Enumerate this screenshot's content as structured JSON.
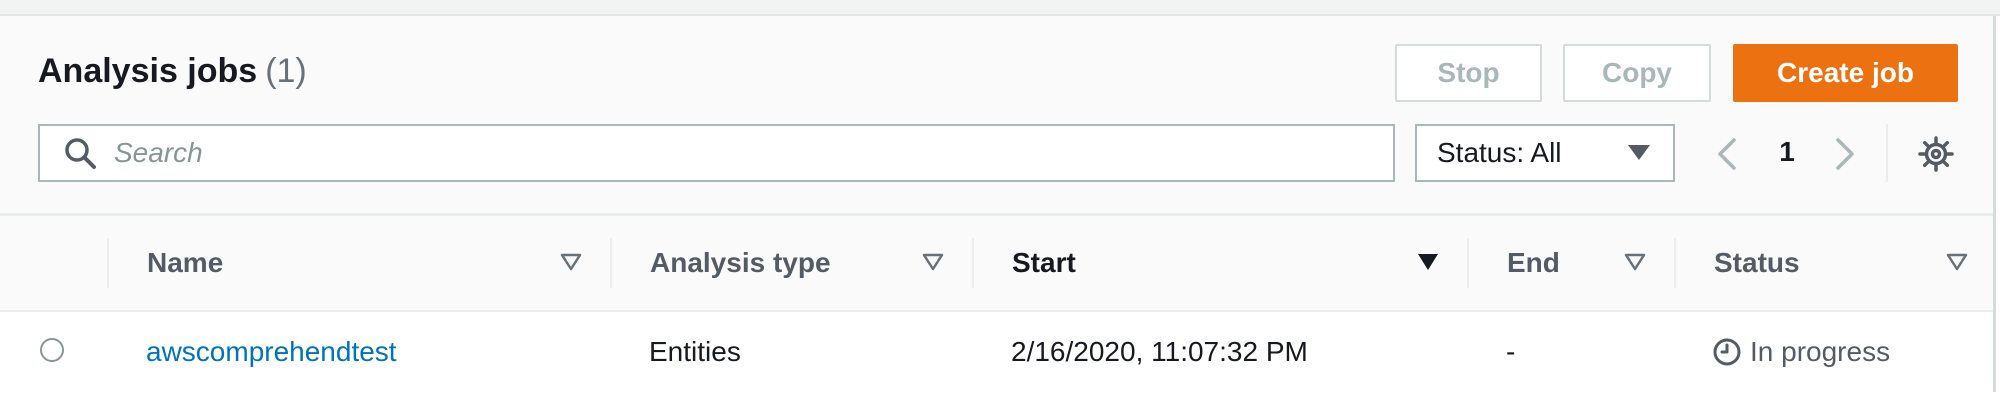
{
  "header": {
    "title": "Analysis jobs",
    "count": "(1)"
  },
  "actions": {
    "stop_label": "Stop",
    "copy_label": "Copy",
    "create_label": "Create job"
  },
  "search": {
    "placeholder": "Search",
    "value": ""
  },
  "status_filter": {
    "selected": "Status: All"
  },
  "pagination": {
    "current_page": "1"
  },
  "table": {
    "columns": [
      {
        "label": "Name",
        "sorted": false
      },
      {
        "label": "Analysis type",
        "sorted": false
      },
      {
        "label": "Start",
        "sorted": true
      },
      {
        "label": "End",
        "sorted": false
      },
      {
        "label": "Status",
        "sorted": false
      }
    ],
    "rows": [
      {
        "name": "awscomprehendtest",
        "analysis_type": "Entities",
        "start": "2/16/2020, 11:07:32 PM",
        "end": "-",
        "status": "In progress"
      }
    ]
  },
  "colors": {
    "primary": "#ec7211",
    "link": "#0073bb",
    "disabled_text": "#aab7b8",
    "header_text": "#545b64"
  }
}
